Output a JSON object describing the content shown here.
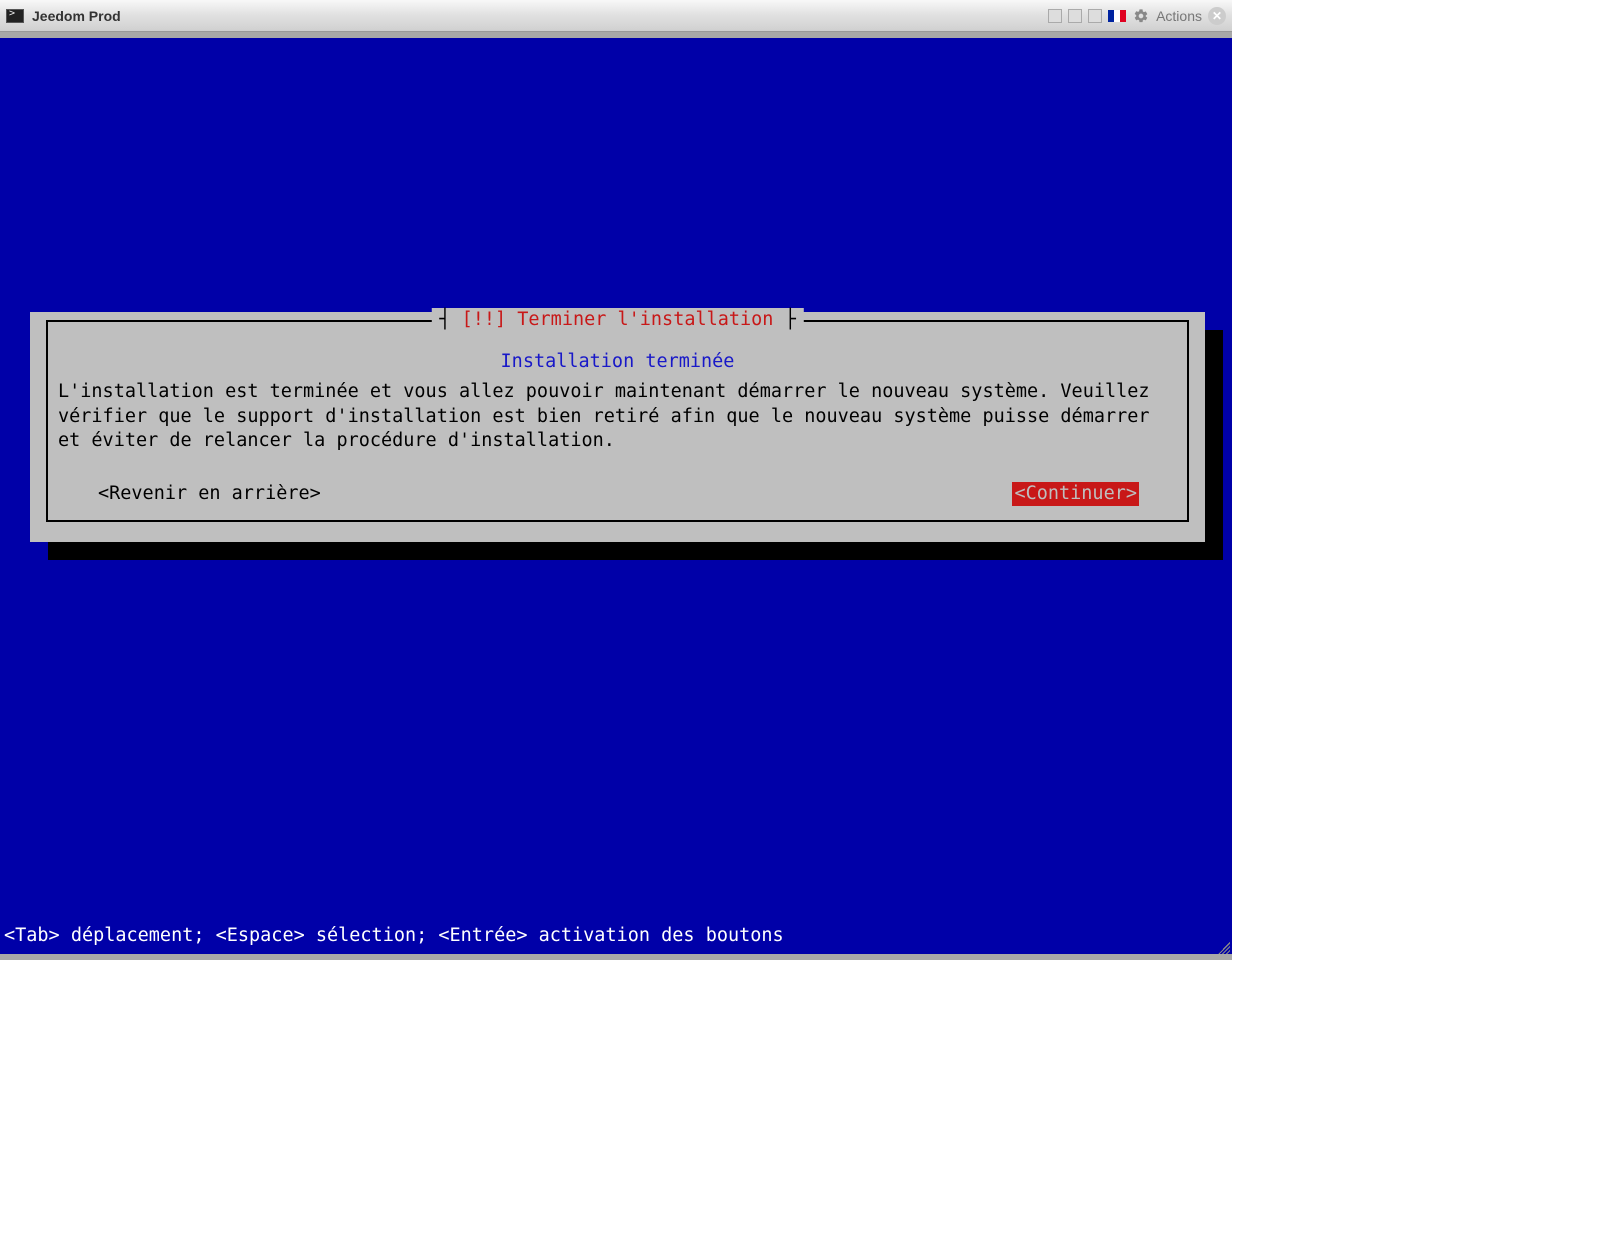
{
  "titlebar": {
    "title": "Jeedom Prod",
    "actions_label": "Actions"
  },
  "dialog": {
    "title_left": "┤ ",
    "title_marker": "[!!]",
    "title_text": " Terminer l'installation ",
    "title_right": " ├",
    "subtitle": "Installation terminée",
    "body": "L'installation est terminée et vous allez pouvoir maintenant démarrer le nouveau système. Veuillez vérifier que le support d'installation est bien retiré afin que le nouveau système puisse démarrer et éviter de relancer la procédure d'installation.",
    "back_button": "<Revenir en arrière>",
    "continue_button": "<Continuer>"
  },
  "footer": {
    "hint": "<Tab> déplacement; <Espace> sélection; <Entrée> activation des boutons"
  },
  "colors": {
    "console_bg": "#0000a8",
    "dialog_bg": "#bfbfbf",
    "red": "#c81818",
    "blue_text": "#1818c8"
  }
}
